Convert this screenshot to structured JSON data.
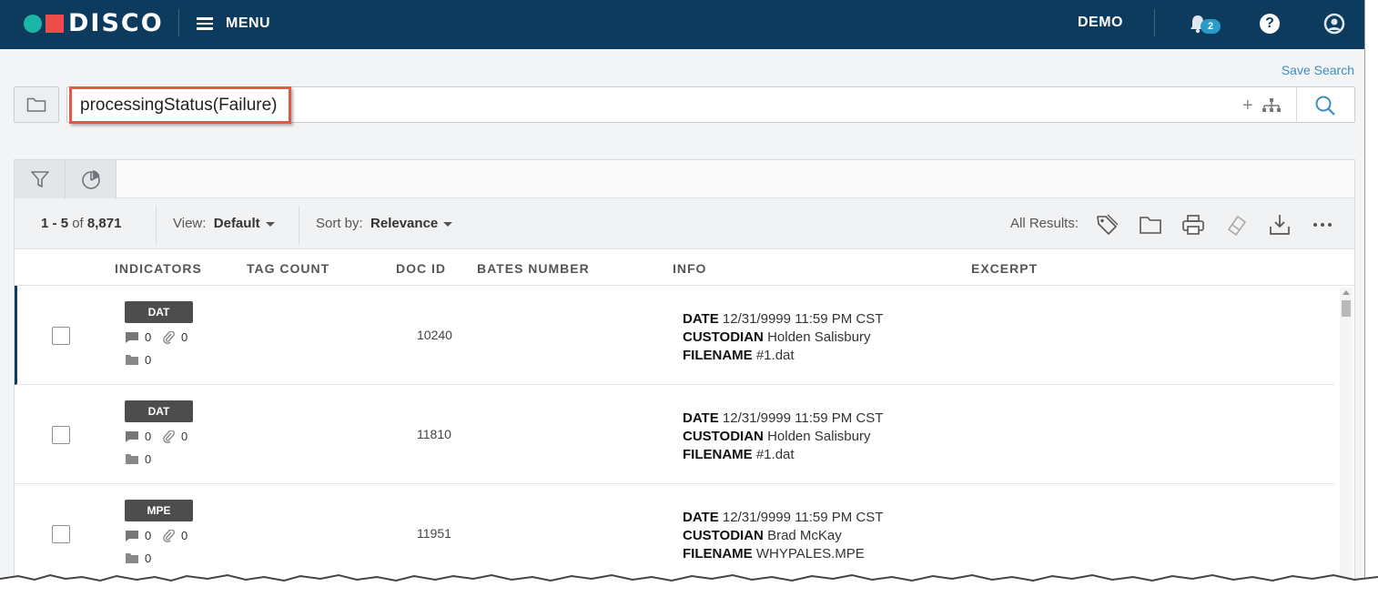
{
  "header": {
    "logo_text": "DISCO",
    "menu_label": "MENU",
    "workspace": "DEMO",
    "notifications_count": "2",
    "help_symbol": "?"
  },
  "search": {
    "save_search_label": "Save Search",
    "query": "processingStatus(Failure)",
    "add_symbol": "+"
  },
  "toolbar": {
    "range_start": "1",
    "range_sep": "-",
    "range_end": "5",
    "of_label": "of",
    "total": "8,871",
    "view_label": "View:",
    "view_value": "Default",
    "sort_label": "Sort by:",
    "sort_value": "Relevance",
    "all_results_label": "All Results:",
    "icons": [
      "tag-icon",
      "folder-icon",
      "print-icon",
      "redact-icon",
      "download-icon",
      "more-icon"
    ]
  },
  "columns": [
    "INDICATORS",
    "TAG COUNT",
    "DOC ID",
    "BATES NUMBER",
    "INFO",
    "EXCERPT"
  ],
  "info_labels": {
    "date": "DATE",
    "custodian": "CUSTODIAN",
    "filename": "FILENAME"
  },
  "rows": [
    {
      "type": "DAT",
      "comments": "0",
      "attachments": "0",
      "folders": "0",
      "doc_id": "10240",
      "date": "12/31/9999 11:59 PM CST",
      "custodian": "Holden Salisbury",
      "filename": "#1.dat"
    },
    {
      "type": "DAT",
      "comments": "0",
      "attachments": "0",
      "folders": "0",
      "doc_id": "11810",
      "date": "12/31/9999 11:59 PM CST",
      "custodian": "Holden Salisbury",
      "filename": "#1.dat"
    },
    {
      "type": "MPE",
      "comments": "0",
      "attachments": "0",
      "folders": "0",
      "doc_id": "11951",
      "date": "12/31/9999 11:59 PM CST",
      "custodian": "Brad McKay",
      "filename": "WHYPALES.MPE"
    }
  ],
  "colors": {
    "header_bg": "#0d3b5e",
    "accent": "#3c8dbc",
    "highlight_border": "#e15a48",
    "logo_teal": "#1ab5a4",
    "logo_red": "#ef4b4b"
  }
}
